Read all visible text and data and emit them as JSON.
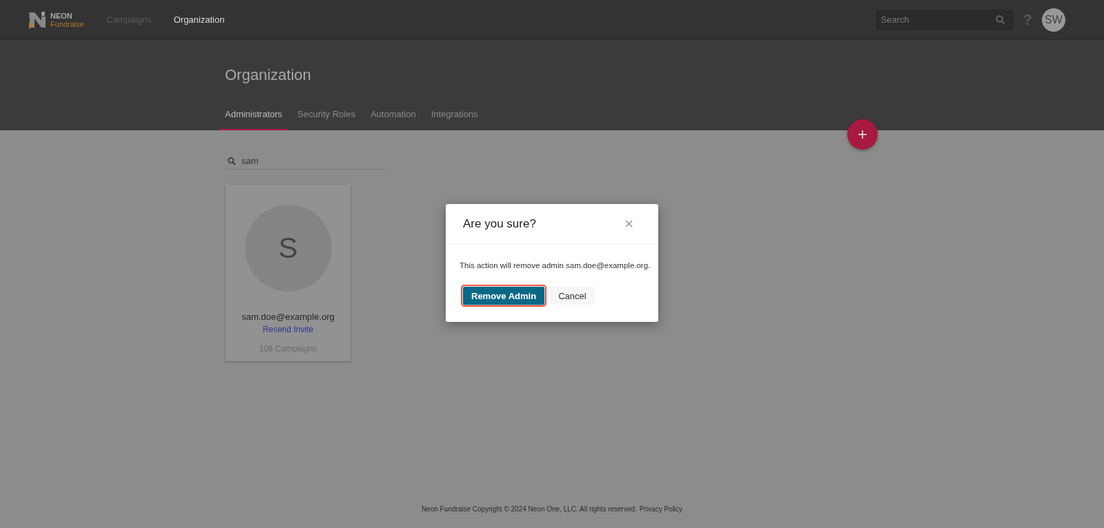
{
  "header": {
    "logo": {
      "brand": "NEON",
      "product": "Fundraise"
    },
    "nav": [
      {
        "label": "Campaigns",
        "selected": false
      },
      {
        "label": "Organization",
        "selected": true
      }
    ],
    "search": {
      "placeholder": "Search"
    },
    "help": "?",
    "avatar": {
      "initials": "SW"
    }
  },
  "page": {
    "title": "Organization",
    "tabs": [
      {
        "label": "Administrators",
        "selected": true
      },
      {
        "label": "Security Roles",
        "selected": false
      },
      {
        "label": "Automation",
        "selected": false
      },
      {
        "label": "Integrations",
        "selected": false
      }
    ],
    "add_button": "+"
  },
  "filter": {
    "value": "sam"
  },
  "admins": [
    {
      "initial": "S",
      "email": "sam.doe@example.org",
      "link": "Resend Invite",
      "campaigns": "106 Campaigns"
    }
  ],
  "dialog": {
    "title": "Are you sure?",
    "close": "×",
    "message": "This action will remove admin sam.doe@example.org.",
    "buttons": [
      {
        "label": "Remove Admin",
        "kind": "primary",
        "highlighted": true
      },
      {
        "label": "Cancel",
        "kind": "secondary",
        "highlighted": false
      }
    ]
  },
  "footer": {
    "text": "Neon Fundraise Copyright © 2024 Neon One, LLC. All rights reserved.",
    "link": "Privacy Policy"
  }
}
